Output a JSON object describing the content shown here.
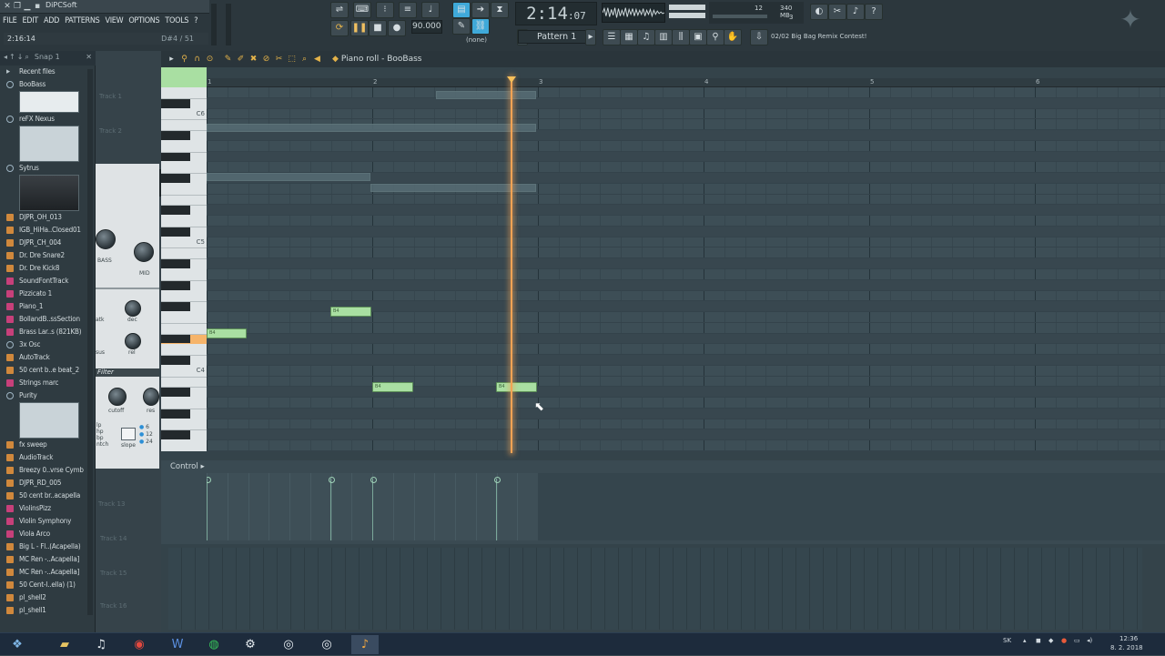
{
  "window": {
    "title": "DiPCSoft"
  },
  "menu": [
    "FILE",
    "EDIT",
    "ADD",
    "PATTERNS",
    "VIEW",
    "OPTIONS",
    "TOOLS",
    "?"
  ],
  "hint": {
    "time": "2:16:14",
    "step": "D#4 / 51"
  },
  "transport": {
    "tempo": "90.000",
    "clock_main": "2:14",
    "clock_sub": ":07",
    "snap_label": "(none)"
  },
  "pattern": {
    "label": "Pattern 1"
  },
  "cpu": {
    "memory": "340 MB",
    "voices": "12",
    "count": "3"
  },
  "hintbar": {
    "text": "02/02  Big Bag Remix Contest!"
  },
  "browser": {
    "header": "Snap 1",
    "items": [
      {
        "label": "Recent files",
        "kind": "folder"
      },
      {
        "label": "BooBass",
        "kind": "plugin"
      },
      {
        "label": "reFX Nexus",
        "kind": "plugin"
      },
      {
        "label": "Sytrus",
        "kind": "plugin"
      },
      {
        "label": "DJPR_OH_013",
        "kind": "sample"
      },
      {
        "label": "IGB_HiHa..Closed01",
        "kind": "sample"
      },
      {
        "label": "DJPR_CH_004",
        "kind": "sample"
      },
      {
        "label": "Dr. Dre Snare2",
        "kind": "sample"
      },
      {
        "label": "Dr. Dre Kick8",
        "kind": "sample"
      },
      {
        "label": "SoundFontTrack",
        "kind": "pink"
      },
      {
        "label": "Pizzicato 1",
        "kind": "pink"
      },
      {
        "label": "Piano_1",
        "kind": "pink"
      },
      {
        "label": "BollandB..ssSection",
        "kind": "pink"
      },
      {
        "label": "Brass Lar..s (821KB)",
        "kind": "pink"
      },
      {
        "label": "3x Osc",
        "kind": "plugin"
      },
      {
        "label": "AutoTrack",
        "kind": "sample"
      },
      {
        "label": "50 cent b..e beat_2",
        "kind": "sample"
      },
      {
        "label": "Strings marc",
        "kind": "pink"
      },
      {
        "label": "Purity",
        "kind": "plugin"
      },
      {
        "label": "fx sweep",
        "kind": "sample"
      },
      {
        "label": "AudioTrack",
        "kind": "sample"
      },
      {
        "label": "Breezy 0..vrse Cymb",
        "kind": "sample"
      },
      {
        "label": "DJPR_RD_005",
        "kind": "sample"
      },
      {
        "label": "50 cent br..acapella",
        "kind": "sample"
      },
      {
        "label": "ViolinsPizz",
        "kind": "pink"
      },
      {
        "label": "Violin Symphony",
        "kind": "pink"
      },
      {
        "label": "Viola Arco",
        "kind": "pink"
      },
      {
        "label": "Big L - Fl..(Acapella)",
        "kind": "sample"
      },
      {
        "label": "MC Ren -..Acapella]",
        "kind": "sample"
      },
      {
        "label": "MC Ren -..Acapella]",
        "kind": "sample"
      },
      {
        "label": "50 Cent-I..ella) (1)",
        "kind": "sample"
      },
      {
        "label": "pl_shell2",
        "kind": "sample"
      },
      {
        "label": "pl_shell1",
        "kind": "sample"
      }
    ]
  },
  "plugin": {
    "labels": {
      "bass": "BASS",
      "mid": "MID",
      "filter": "Filter",
      "cutoff": "cutoff",
      "res": "res",
      "slope": "slope",
      "atk": "atk",
      "dec": "dec",
      "sus": "sus",
      "rel": "rel",
      "modes": [
        "lp",
        "hp",
        "bp",
        "ntch"
      ],
      "slopes": [
        "6",
        "12",
        "24"
      ]
    }
  },
  "piano_roll": {
    "title": "Piano roll",
    "channel": "BooBass",
    "bars": [
      "1",
      "2",
      "3",
      "4",
      "5",
      "6"
    ],
    "key_labels": {
      "c6": "C6",
      "c5": "C5",
      "c4": "C4"
    },
    "control_label": "Control",
    "note_label": "B4"
  },
  "playlist": {
    "tracks": [
      "Track 1",
      "Track 2",
      "Track 13",
      "Track 14",
      "Track 15",
      "Track 16"
    ]
  },
  "tray": {
    "lang": "SK",
    "time": "12:36",
    "date": "8. 2. 2018"
  },
  "colors": {
    "accent": "#f3a354",
    "note": "#a9dfa2",
    "grid": "#3d4e56"
  }
}
